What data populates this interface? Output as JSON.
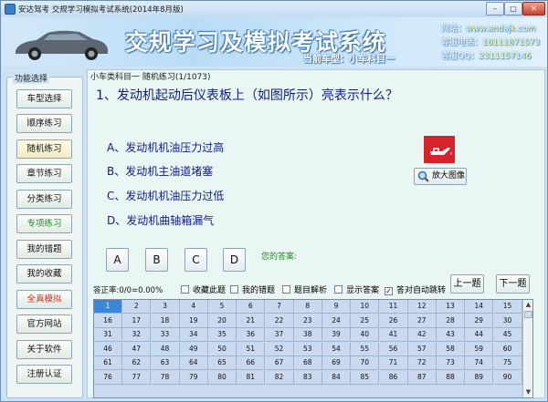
{
  "window": {
    "title": "安达驾考 交规学习模拟考试系统(2014年8月版)",
    "minimize": "–",
    "maximize": "□",
    "close": "✕"
  },
  "banner": {
    "app_name": "交规学习及模拟考试系统",
    "current_type_label": "当前车型：",
    "current_type_value": "小车科目一",
    "website_label": "网站：",
    "website_value": "www.andajk.com",
    "phone_label": "客服电话：",
    "phone_value": "18111871573",
    "qq_label": "客服QQ：",
    "qq_value": "2311157146"
  },
  "sidebar": {
    "title": "功能选择",
    "items": [
      {
        "label": "车型选择",
        "style": "normal"
      },
      {
        "label": "顺序练习",
        "style": "normal"
      },
      {
        "label": "随机练习",
        "style": "active"
      },
      {
        "label": "章节练习",
        "style": "normal"
      },
      {
        "label": "分类练习",
        "style": "normal"
      },
      {
        "label": "专项练习",
        "style": "green"
      },
      {
        "label": "我的错题",
        "style": "normal"
      },
      {
        "label": "我的收藏",
        "style": "normal"
      },
      {
        "label": "全真模拟",
        "style": "red"
      },
      {
        "label": "官方网站",
        "style": "normal"
      },
      {
        "label": "关于软件",
        "style": "normal"
      },
      {
        "label": "注册认证",
        "style": "normal"
      }
    ]
  },
  "main": {
    "title": "小车类科目一  随机练习(1/1073)",
    "question": "1、发动机起动后仪表板上（如图所示）亮表示什么？",
    "options": [
      "A、发动机机油压力过高",
      "B、发动机主油道堵塞",
      "C、发动机机油压力过低",
      "D、发动机曲轴箱漏气"
    ],
    "image_icon": "oil-pressure-warning-icon",
    "zoom_label": "放大图像",
    "answer_buttons": [
      "A",
      "B",
      "C",
      "D"
    ],
    "your_answer_label": "您的答案:",
    "accuracy_text": "答正率:0/0=0.00%",
    "checkboxes": [
      {
        "label": "收藏此题",
        "checked": false
      },
      {
        "label": "我的错题",
        "checked": false
      },
      {
        "label": "题目解析",
        "checked": false
      },
      {
        "label": "显示答案",
        "checked": false
      },
      {
        "label": "答对自动跳转",
        "checked": true
      }
    ],
    "prev_label": "上一题",
    "next_label": "下一题",
    "current_question": 1,
    "grid_numbers": [
      "1",
      "2",
      "3",
      "4",
      "5",
      "6",
      "7",
      "8",
      "9",
      "10",
      "11",
      "12",
      "13",
      "14",
      "15",
      "16",
      "17",
      "18",
      "19",
      "20",
      "21",
      "22",
      "23",
      "24",
      "25",
      "26",
      "27",
      "28",
      "29",
      "30",
      "31",
      "32",
      "33",
      "34",
      "35",
      "36",
      "37",
      "38",
      "39",
      "40",
      "41",
      "42",
      "43",
      "44",
      "45",
      "46",
      "47",
      "48",
      "49",
      "50",
      "51",
      "52",
      "53",
      "54",
      "55",
      "56",
      "57",
      "58",
      "59",
      "60",
      "61",
      "62",
      "63",
      "64",
      "65",
      "66",
      "67",
      "68",
      "69",
      "70",
      "71",
      "72",
      "73",
      "74",
      "75",
      "76",
      "77",
      "78",
      "79",
      "80",
      "81",
      "82",
      "83",
      "84",
      "85",
      "86",
      "87",
      "88",
      "89",
      "90"
    ],
    "scroll_up": "▲",
    "scroll_down": "▼"
  },
  "colors": {
    "question_text": "#0f1c8c",
    "grid_bg": "#c8d9f0",
    "grid_current": "#3b86d9",
    "warning_icon": "#d6232b"
  }
}
